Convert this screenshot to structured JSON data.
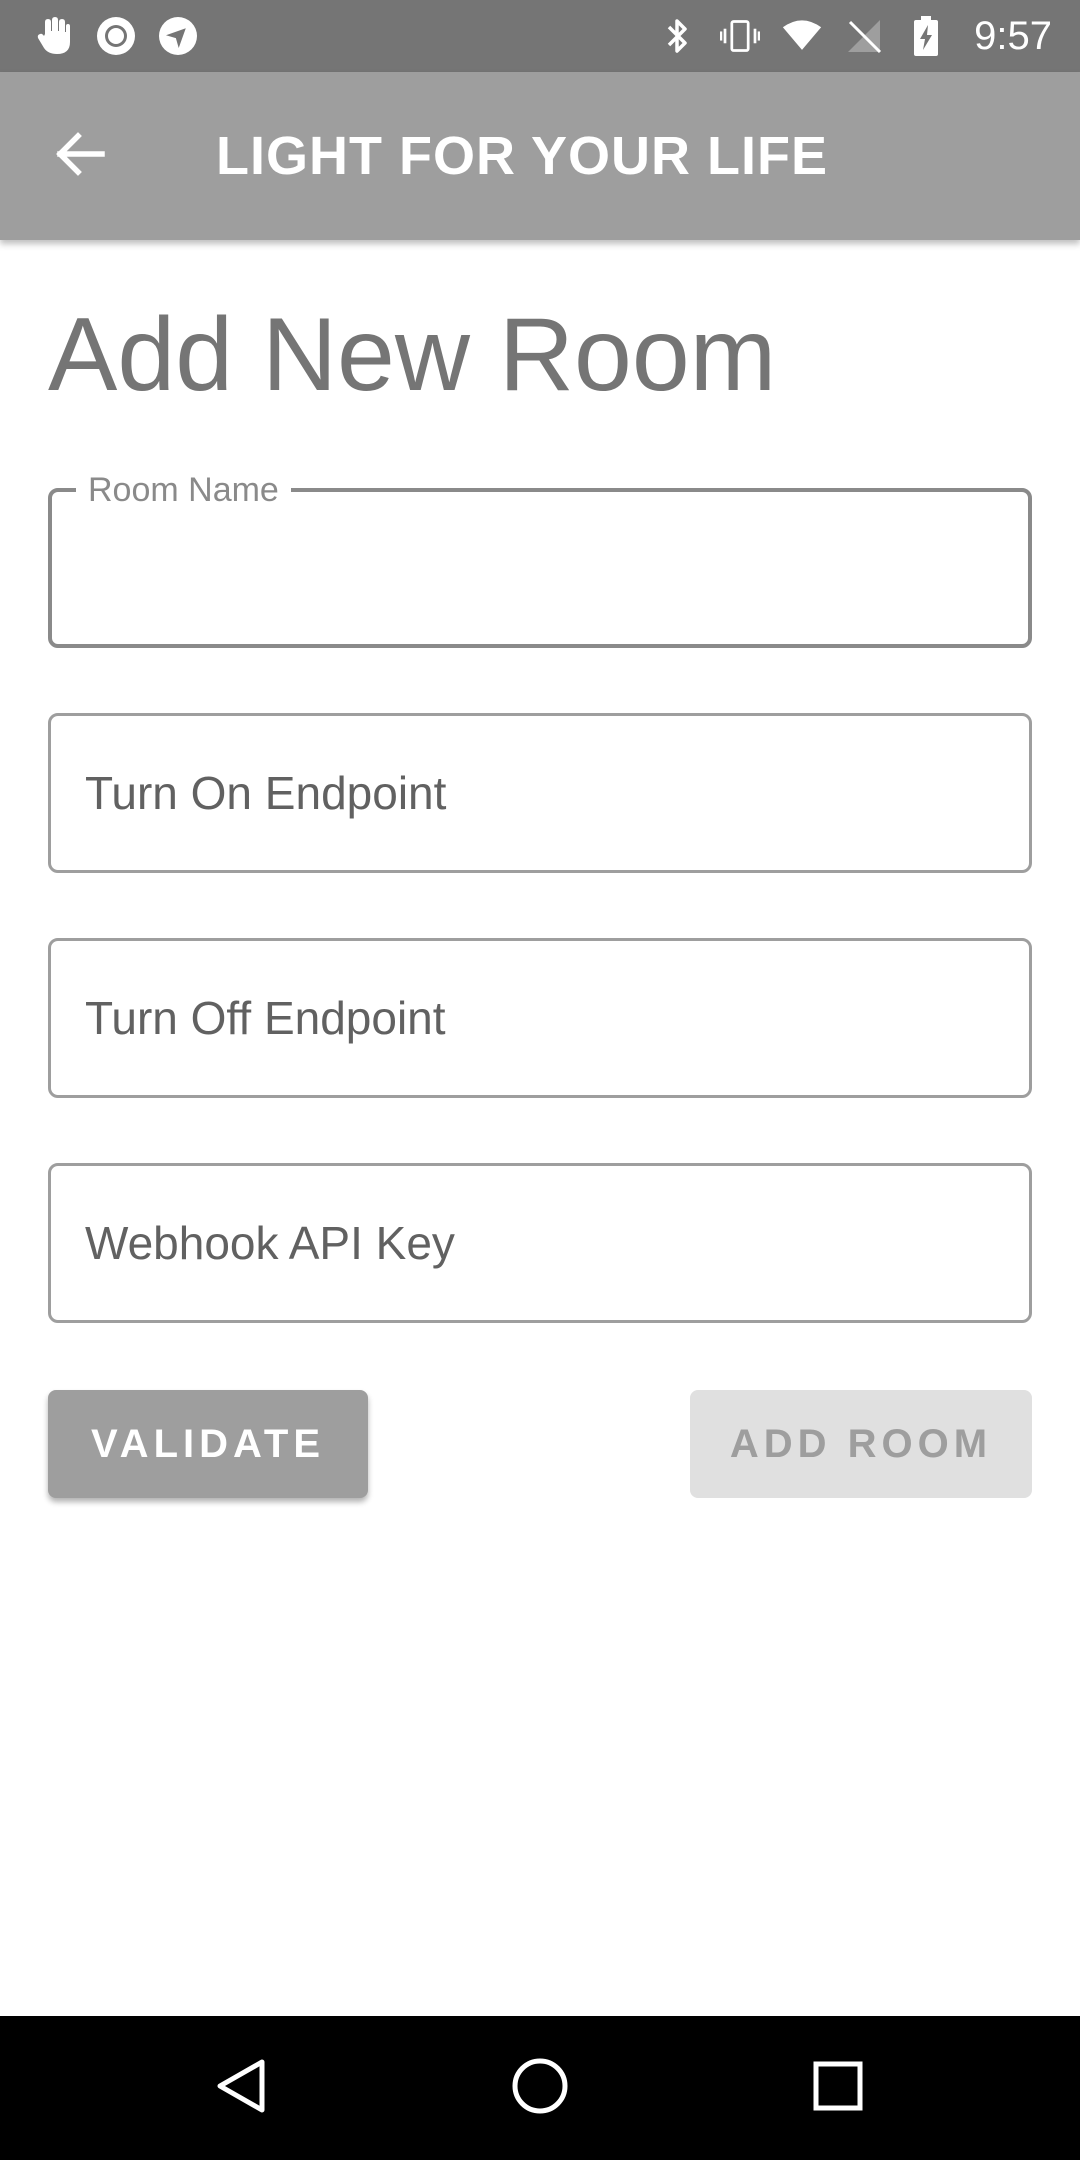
{
  "status_bar": {
    "time": "9:57",
    "left_icons": [
      "hand-touch-icon",
      "record-icon",
      "navigation-icon"
    ],
    "right_icons": [
      "bluetooth-icon",
      "vibrate-icon",
      "wifi-icon",
      "no-sim-icon",
      "battery-charging-icon"
    ]
  },
  "app_bar": {
    "title": "LIGHT FOR YOUR LIFE",
    "back_icon": "arrow-back-icon"
  },
  "page": {
    "title": "Add New Room"
  },
  "form": {
    "room_name": {
      "label": "Room Name",
      "value": ""
    },
    "turn_on_endpoint": {
      "placeholder": "Turn On Endpoint",
      "value": ""
    },
    "turn_off_endpoint": {
      "placeholder": "Turn Off Endpoint",
      "value": ""
    },
    "webhook_api_key": {
      "placeholder": "Webhook API Key",
      "value": ""
    }
  },
  "buttons": {
    "validate_label": "VALIDATE",
    "add_room_label": "ADD ROOM"
  },
  "nav_bar": {
    "icons": [
      "back-triangle-icon",
      "home-circle-icon",
      "recents-square-icon"
    ]
  },
  "colors": {
    "status_bar": "#757575",
    "app_bar": "#9e9e9e",
    "validate_button": "#9e9e9e",
    "add_room_button_disabled": "#e0e0e0"
  }
}
